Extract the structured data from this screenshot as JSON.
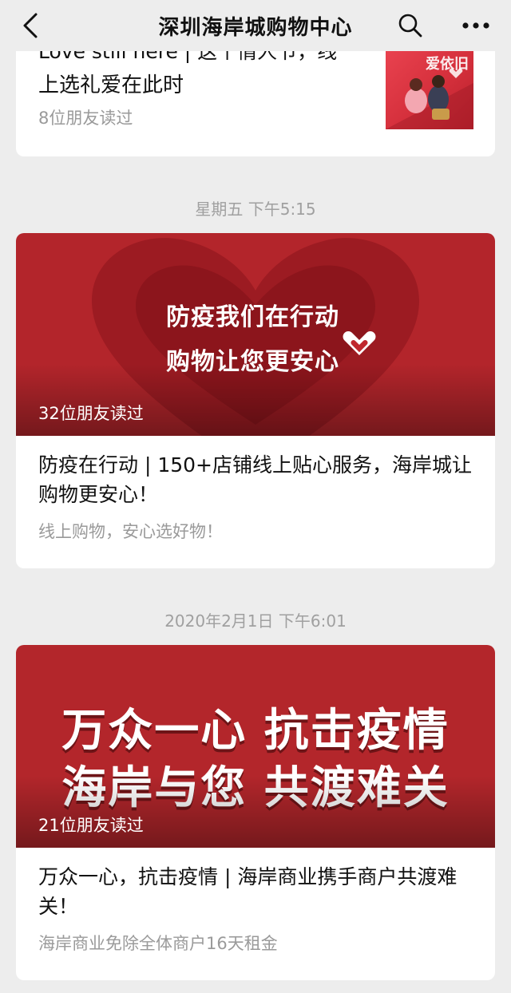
{
  "navbar": {
    "title": "深圳海岸城购物中心",
    "back_icon": "chevron-left-icon",
    "search_icon": "search-icon",
    "more_icon": "more-icon"
  },
  "articles_partial": {
    "title_line1": "Love still here | 这个情人节，线",
    "title_line2": "上选礼爱在此时",
    "reads": "8位朋友读过",
    "thumb_text": "爱依旧"
  },
  "groups": [
    {
      "timestamp": "星期五 下午5:15",
      "cover_line1": "防疫我们在行动",
      "cover_line2": "购物让您更安心",
      "reads": "32位朋友读过",
      "title": "防疫在行动 | 150+店铺线上贴心服务，海岸城让购物更安心！",
      "digest": "线上购物，安心选好物！"
    },
    {
      "timestamp": "2020年2月1日 下午6:01",
      "cover_line1": "万众一心 抗击疫情",
      "cover_line2": "海岸与您 共渡难关",
      "reads": "21位朋友读过",
      "title": "万众一心，抗击疫情 | 海岸商业携手商户共渡难关！",
      "digest": "海岸商业免除全体商户16天租金"
    }
  ],
  "colors": {
    "background": "#ededed",
    "card": "#ffffff",
    "cover_red": "#b3252b",
    "muted_text": "#9a9a9a"
  }
}
